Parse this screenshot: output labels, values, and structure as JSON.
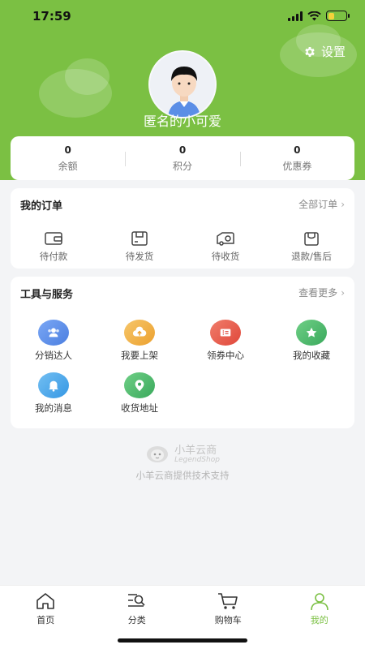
{
  "status_bar": {
    "time": "17:59"
  },
  "header": {
    "settings_label": "设置",
    "username": "匿名的小可爱",
    "accent_color": "#7bc043"
  },
  "stats": [
    {
      "value": "0",
      "label": "余额"
    },
    {
      "value": "0",
      "label": "积分"
    },
    {
      "value": "0",
      "label": "优惠券"
    }
  ],
  "orders": {
    "title": "我的订单",
    "more_label": "全部订单",
    "items": [
      {
        "label": "待付款",
        "icon": "wallet-icon"
      },
      {
        "label": "待发货",
        "icon": "package-icon"
      },
      {
        "label": "待收货",
        "icon": "delivery-icon"
      },
      {
        "label": "退款/售后",
        "icon": "refund-icon"
      }
    ]
  },
  "tools": {
    "title": "工具与服务",
    "more_label": "查看更多",
    "items": [
      {
        "label": "分销达人",
        "icon": "distributor-icon",
        "color": "#5b8def"
      },
      {
        "label": "我要上架",
        "icon": "upload-cloud-icon",
        "color": "#f0b03f"
      },
      {
        "label": "领券中心",
        "icon": "coupon-icon",
        "color": "#e85c4a"
      },
      {
        "label": "我的收藏",
        "icon": "favorite-icon",
        "color": "#4cb86b"
      },
      {
        "label": "我的消息",
        "icon": "bell-icon",
        "color": "#4aa7ea"
      },
      {
        "label": "收货地址",
        "icon": "location-pin-icon",
        "color": "#4cb86b"
      }
    ]
  },
  "brand": {
    "name": "小羊云商",
    "sub": "LegendShop",
    "support": "小羊云商提供技术支持"
  },
  "tabbar": {
    "items": [
      {
        "label": "首页",
        "icon": "home-icon",
        "active": false
      },
      {
        "label": "分类",
        "icon": "category-search-icon",
        "active": false
      },
      {
        "label": "购物车",
        "icon": "cart-icon",
        "active": false
      },
      {
        "label": "我的",
        "icon": "user-icon",
        "active": true
      }
    ]
  }
}
